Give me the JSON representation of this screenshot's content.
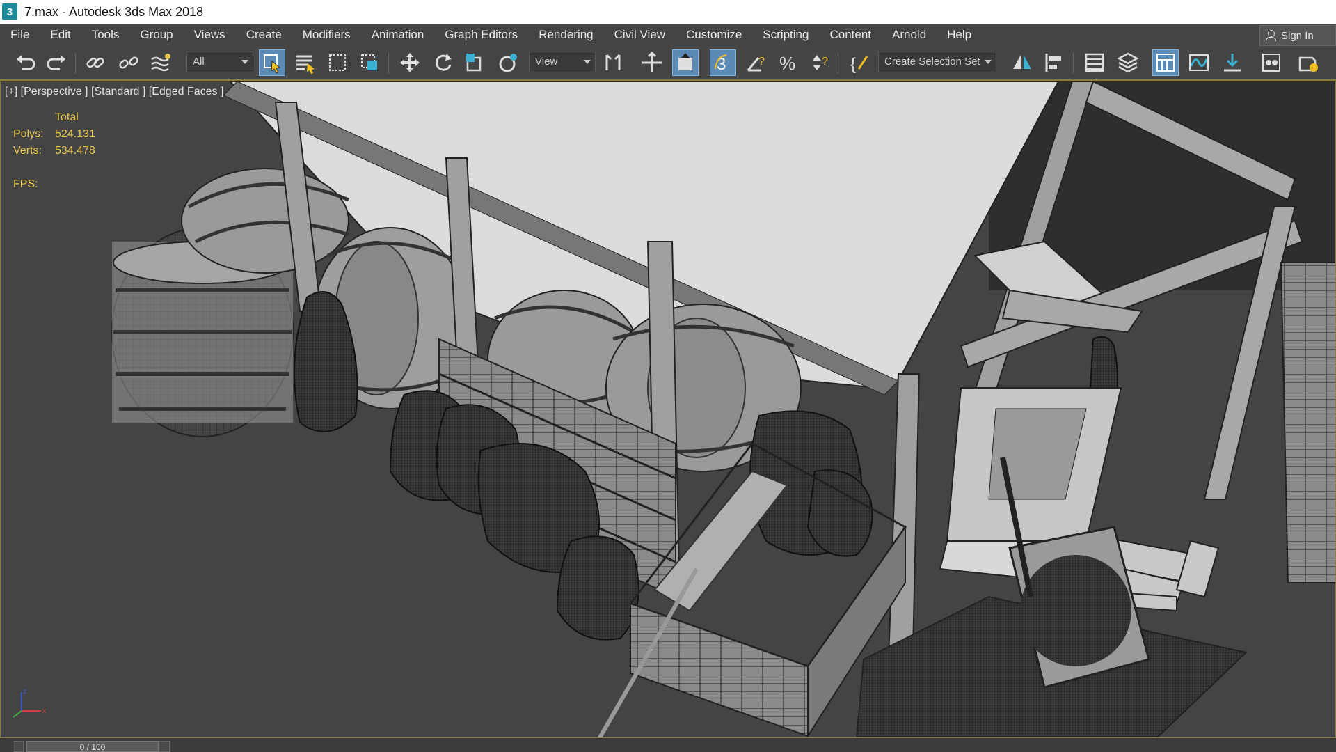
{
  "window": {
    "title": "7.max - Autodesk 3ds Max 2018",
    "logo_text": "3"
  },
  "menu": [
    "File",
    "Edit",
    "Tools",
    "Group",
    "Views",
    "Create",
    "Modifiers",
    "Animation",
    "Graph Editors",
    "Rendering",
    "Civil View",
    "Customize",
    "Scripting",
    "Content",
    "Arnold",
    "Help"
  ],
  "signin_label": "Sign In",
  "toolbar": {
    "selection_filter": "All",
    "reference_coord": "View",
    "named_selection": "Create Selection Set"
  },
  "viewport": {
    "label": "[+] [Perspective ] [Standard ] [Edged Faces ]",
    "stats": {
      "total_label": "Total",
      "polys_label": "Polys:",
      "polys_value": "524.131",
      "verts_label": "Verts:",
      "verts_value": "534.478",
      "fps_label": "FPS:"
    }
  },
  "timeline": {
    "frame": "0 / 100"
  },
  "colors": {
    "ui_bg": "#444444",
    "stats_text": "#e8c84a",
    "active_tool": "#5b8bb5",
    "viewport_border": "#8a7c3a"
  }
}
